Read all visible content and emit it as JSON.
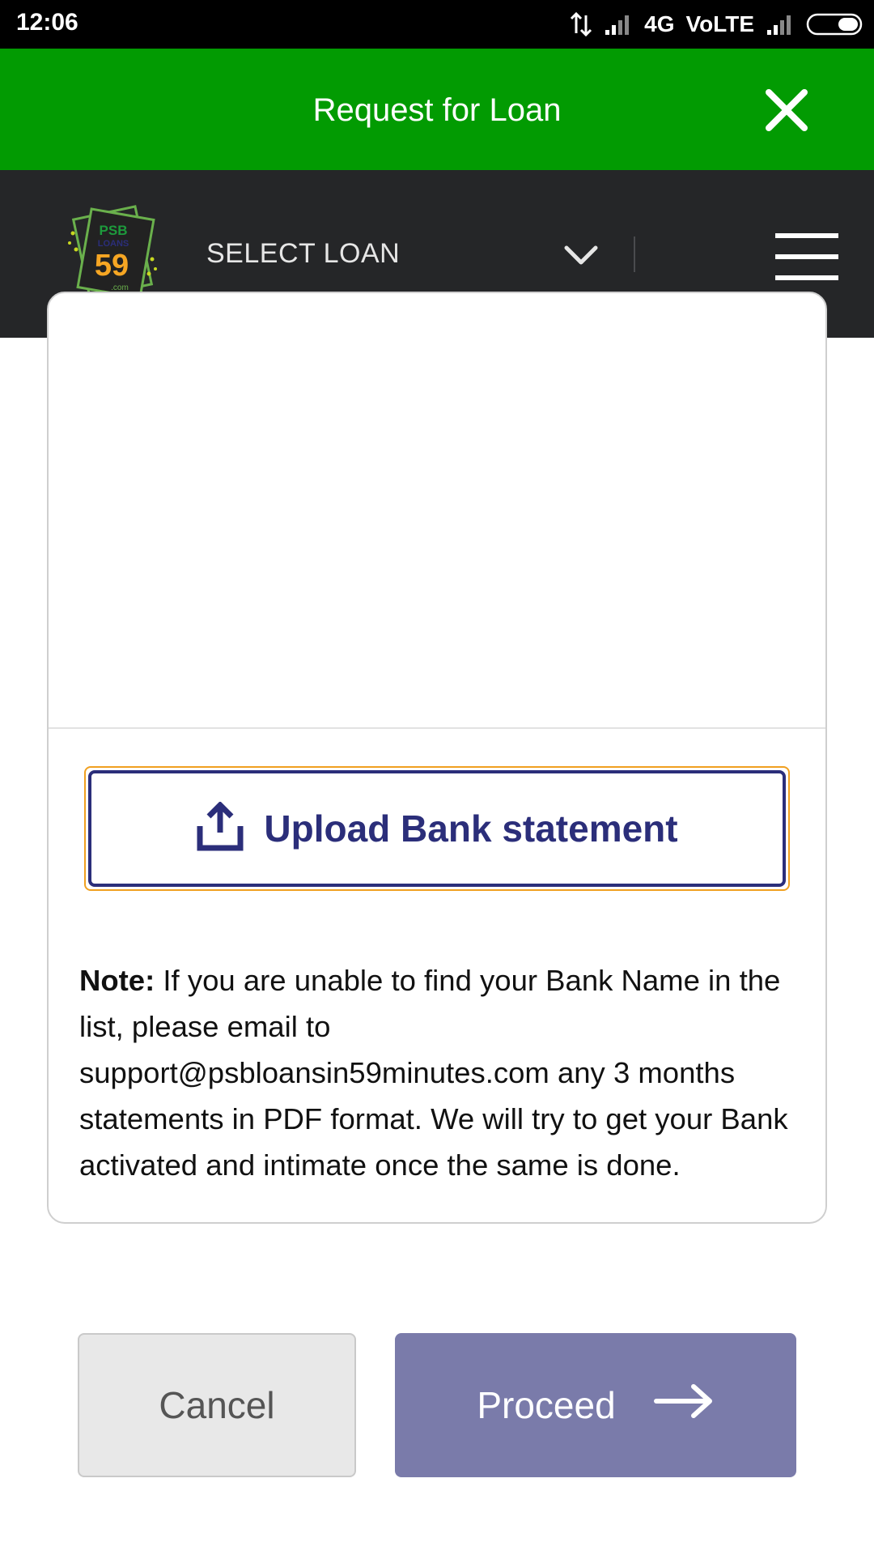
{
  "status_bar": {
    "time": "12:06",
    "network": "4G",
    "volte": "VoLTE",
    "icons": [
      "data-transfer-icon",
      "signal-icon",
      "signal-icon",
      "battery-icon"
    ]
  },
  "header": {
    "title": "Request for Loan",
    "close_icon": "close-icon",
    "background": "#029b02"
  },
  "nav": {
    "logo_text": [
      "PSB",
      "LOANS",
      "59",
      ".com"
    ],
    "select_label": "SELECT LOAN",
    "dropdown_icon": "chevron-down-icon",
    "menu_icon": "hamburger-menu-icon",
    "background": "#252628"
  },
  "card": {
    "upload_label": "Upload Bank statement",
    "upload_icon": "upload-icon",
    "note_label": "Note:",
    "note_text": " If you are unable to find your Bank Name in the list, please email to support@psbloansin59minutes.com any 3 months statements in PDF format. We will try to get your Bank activated and intimate once the same is done."
  },
  "actions": {
    "cancel_label": "Cancel",
    "proceed_label": "Proceed",
    "proceed_icon": "arrow-right-icon",
    "proceed_color": "#7a7baa"
  }
}
